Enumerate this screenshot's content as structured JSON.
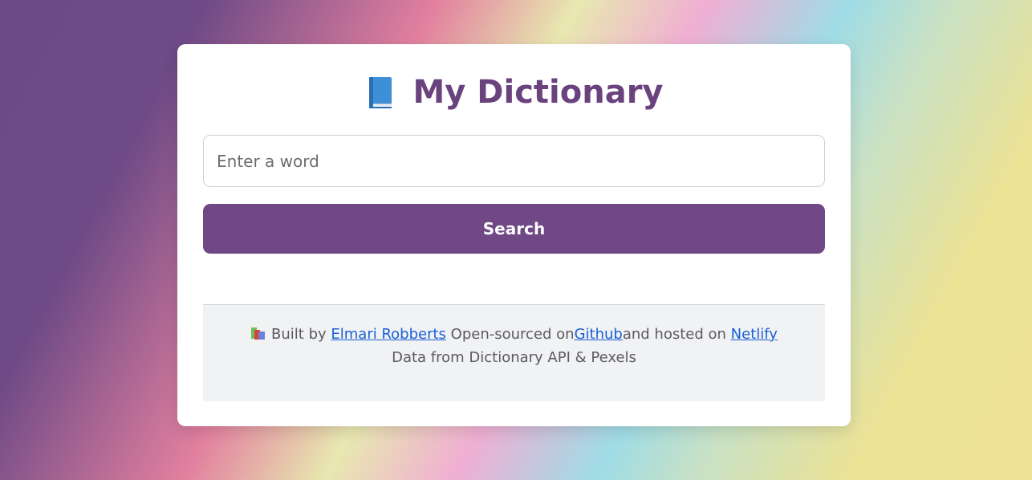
{
  "header": {
    "title": "My Dictionary",
    "icon": "book-icon"
  },
  "search": {
    "placeholder": "Enter a word",
    "value": "",
    "button_label": "Search"
  },
  "footer": {
    "icon": "books-icon",
    "built_by_prefix": "Built by",
    "author_link": "Elmari Robberts",
    "open_sourced_text": "Open-sourced on",
    "github_link": "Github",
    "hosted_text": "and hosted on",
    "netlify_link": "Netlify",
    "data_from_text": "Data from Dictionary API & Pexels"
  },
  "colors": {
    "accent": "#6f4885",
    "title": "#6a437e",
    "link": "#1a5fd6",
    "footer_bg": "#f1f2f4"
  }
}
